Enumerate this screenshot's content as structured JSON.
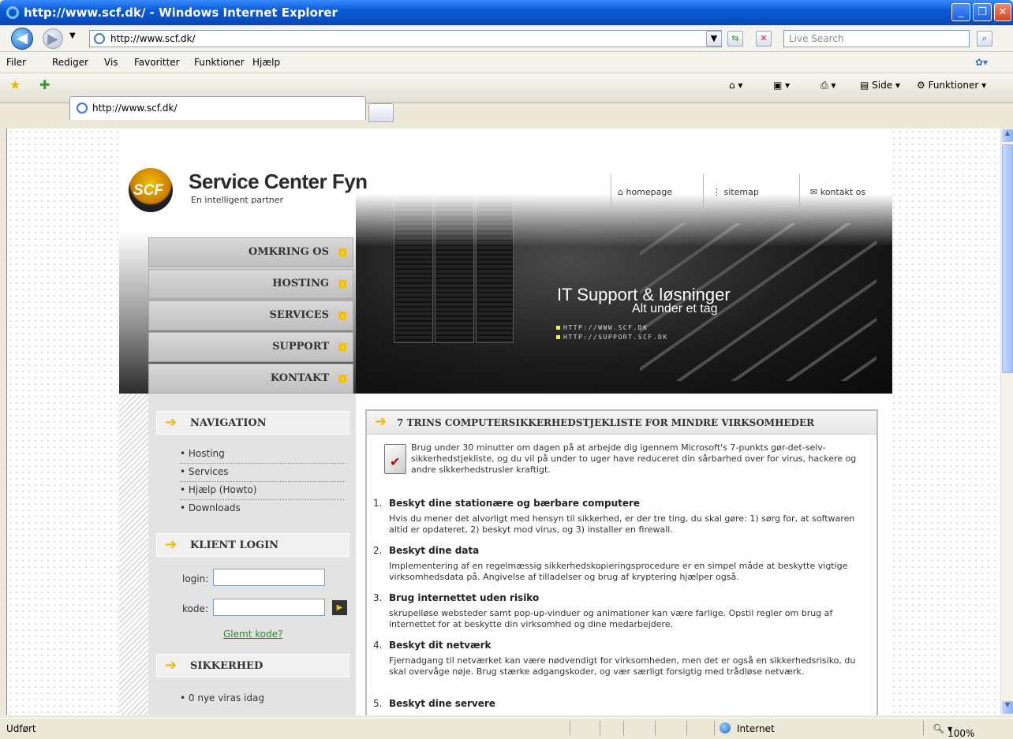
{
  "window": {
    "title": "http://www.scf.dk/ - Windows Internet Explorer",
    "minimize": "_",
    "maximize": "❐",
    "close": "✕"
  },
  "address": {
    "url": "http://www.scf.dk/",
    "search_placeholder": "Live Search"
  },
  "menu": [
    "Filer",
    "Rediger",
    "Vis",
    "Favoritter",
    "Funktioner",
    "Hjælp"
  ],
  "tabs": {
    "active_label": "http://www.scf.dk/",
    "side_label": "Side",
    "tools_label": "Funktioner"
  },
  "site": {
    "brand": "Service Center Fyn",
    "tagline": "En intelligent partner",
    "logo_text": "SCF",
    "toplinks": [
      "homepage",
      "sitemap",
      "kontakt os"
    ],
    "hero_title": "IT Support & løsninger",
    "hero_sub": "Alt under et tag",
    "hero_urls": [
      "HTTP://WWW.SCF.DK",
      "HTTP://SUPPORT.SCF.DK"
    ],
    "nav": [
      "OMKRING OS",
      "HOSTING",
      "SERVICES",
      "SUPPORT",
      "KONTAKT"
    ],
    "sidebar": {
      "navigation_title": "NAVIGATION",
      "links": [
        "• Hosting",
        "• Services",
        "• Hjælp (Howto)",
        "• Downloads"
      ],
      "login_title": "KLIENT LOGIN",
      "login_label": "login:",
      "code_label": "kode:",
      "forgot": "Glemt kode?",
      "security_title": "SIKKERHED",
      "security_item": "• 0 nye viras idag"
    },
    "article": {
      "title": "7 TRINS COMPUTERSIKKERHEDSTJEKLISTE FOR MINDRE VIRKSOMHEDER",
      "intro": "Brug under 30 minutter om dagen på at arbejde dig igennem Microsoft's 7-punkts gør-det-selv-sikkerhedstjekliste, og du vil på under to uger have reduceret din sårbarhed over for virus, hackere og andre sikkerhedstrusler kraftigt.",
      "items": [
        {
          "num": "1.",
          "head": "Beskyt dine stationære og bærbare computere",
          "body": "Hvis du mener det alvorligt med hensyn til sikkerhed, er der tre ting, du skal gøre: 1) sørg for, at softwaren altid er opdateret, 2) beskyt mod virus, og 3) installer en firewall."
        },
        {
          "num": "2.",
          "head": "Beskyt dine data",
          "body": "Implementering af en regelmæssig sikkerhedskopieringsprocedure er en simpel måde at beskytte vigtige virksomhedsdata på. Angivelse af tilladelser og brug af kryptering hjælper også."
        },
        {
          "num": "3.",
          "head": "Brug internettet uden risiko",
          "body": "skrupelløse websteder samt pop-up-vinduer og animationer kan være farlige. Opstil regler om brug af internettet for at beskytte din virksomhed og dine medarbejdere."
        },
        {
          "num": "4.",
          "head": "Beskyt dit netværk",
          "body": "Fjernadgang til netværket kan være nødvendigt for virksomheden, men det er også en sikkerhedsrisiko, du skal overvåge nøje. Brug stærke adgangskoder, og vær særligt forsigtig med trådløse netværk."
        },
        {
          "num": "5.",
          "head": "Beskyt dine servere",
          "body": ""
        }
      ]
    }
  },
  "status": {
    "text": "Udført",
    "zone": "Internet",
    "zoom": "100%"
  }
}
